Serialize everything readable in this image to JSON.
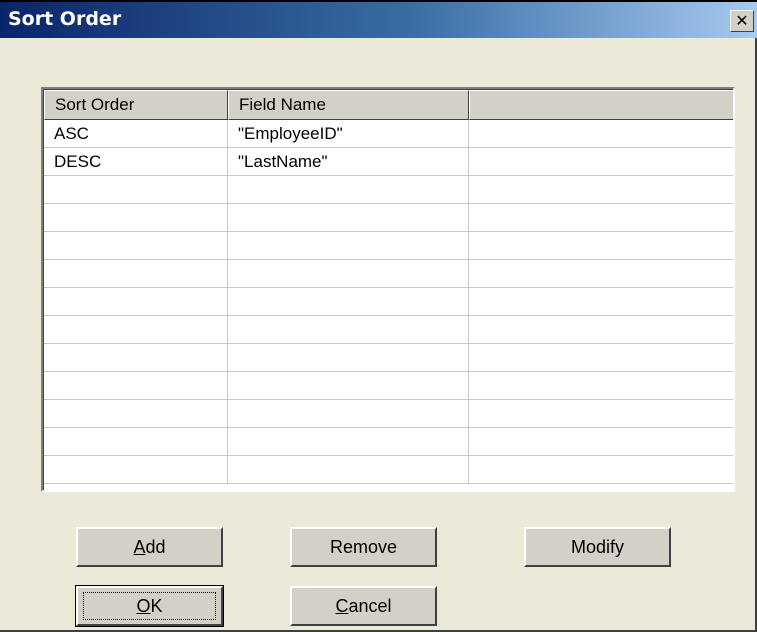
{
  "window": {
    "title": "Sort Order",
    "close_glyph": "✕"
  },
  "grid": {
    "columns": [
      "Sort Order",
      "Field Name",
      ""
    ],
    "rows": [
      [
        "ASC",
        "\"EmployeeID\""
      ],
      [
        "DESC",
        "\"LastName\""
      ],
      [
        "",
        ""
      ],
      [
        "",
        ""
      ],
      [
        "",
        ""
      ],
      [
        "",
        ""
      ],
      [
        "",
        ""
      ],
      [
        "",
        ""
      ],
      [
        "",
        ""
      ],
      [
        "",
        ""
      ],
      [
        "",
        ""
      ],
      [
        "",
        ""
      ],
      [
        "",
        ""
      ]
    ]
  },
  "buttons": {
    "add": {
      "mnemonic": "A",
      "rest": "dd"
    },
    "remove": {
      "label": "Remove"
    },
    "modify": {
      "label": "Modify"
    },
    "ok": {
      "mnemonic": "O",
      "rest": "K"
    },
    "cancel": {
      "mnemonic": "C",
      "rest": "ancel"
    }
  }
}
